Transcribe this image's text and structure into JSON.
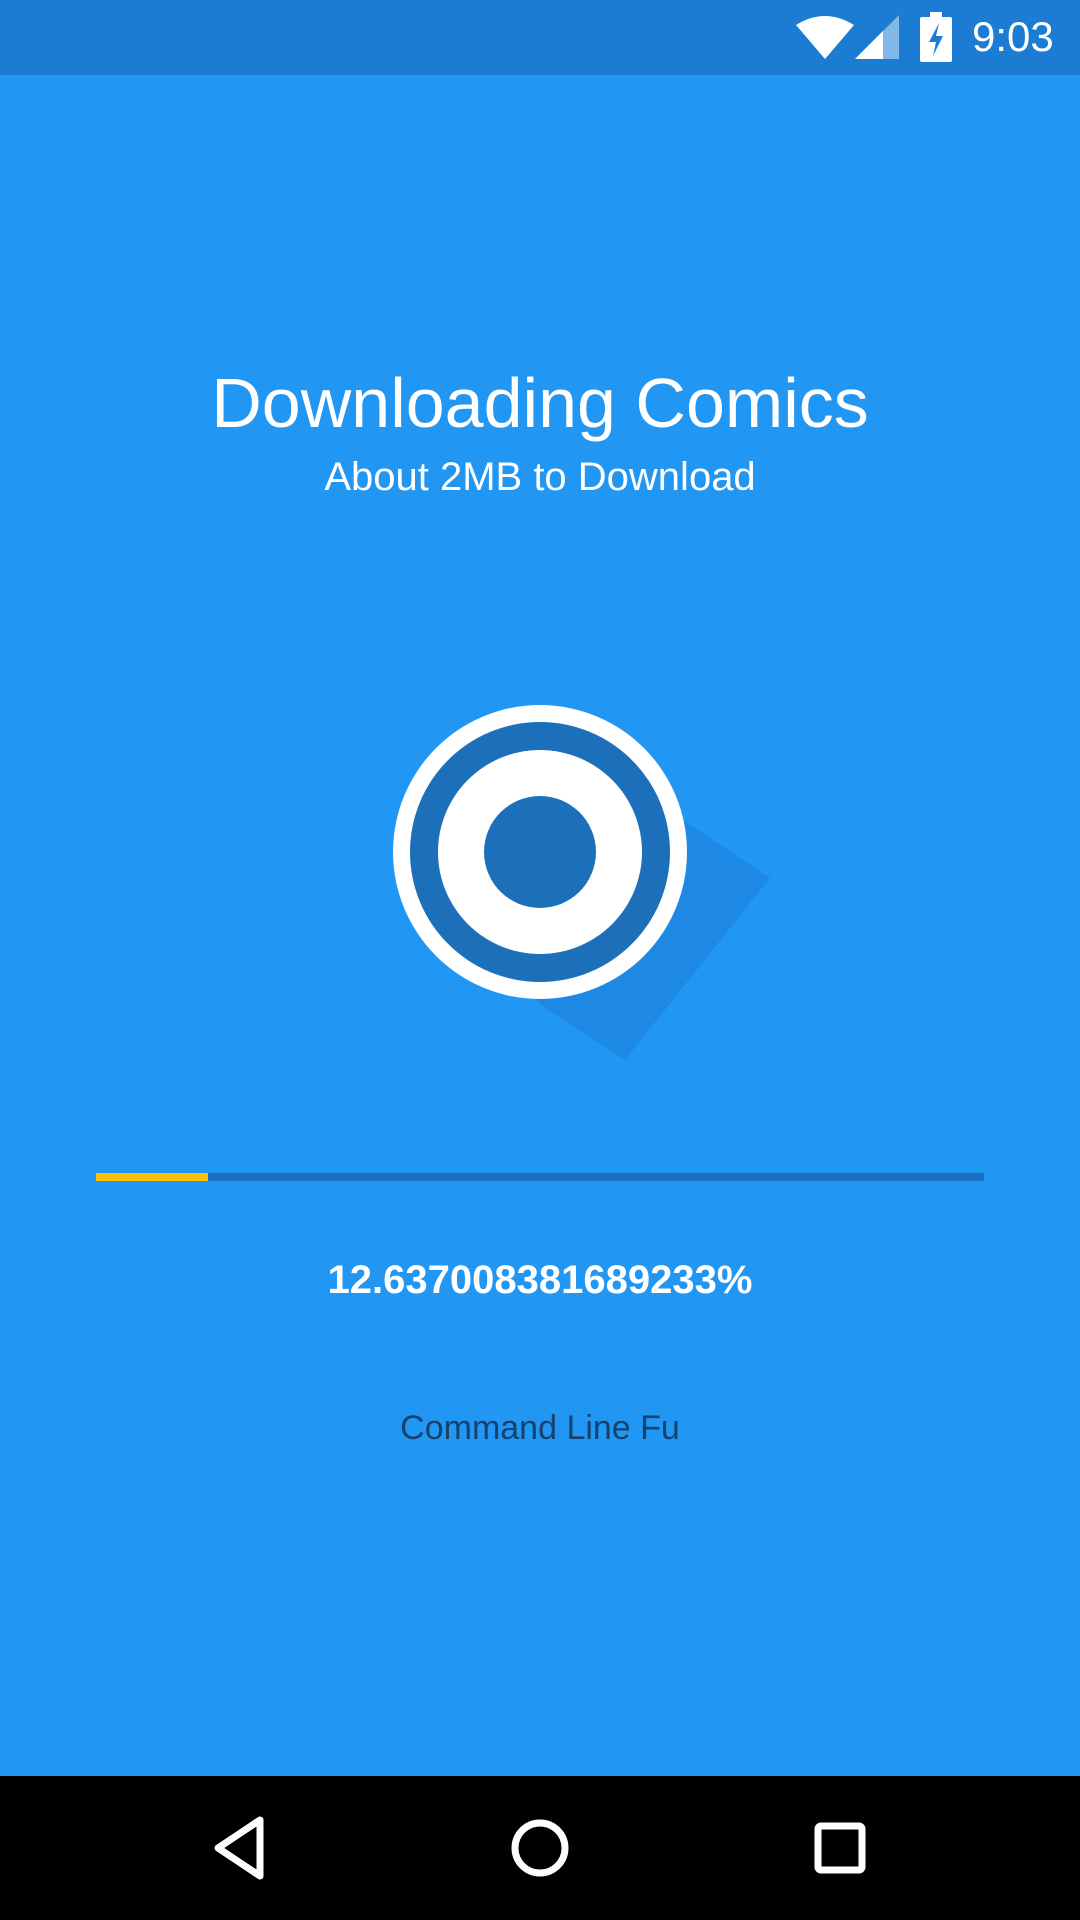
{
  "status_bar": {
    "time": "9:03",
    "icons": [
      "wifi-icon",
      "cell-signal-icon",
      "battery-charging-icon"
    ]
  },
  "download": {
    "title": "Downloading Comics",
    "subtitle": "About 2MB to Download",
    "progress_percent": 12.637008381689233,
    "progress_text": "12.637008381689233%",
    "current_item": "Command Line Fu"
  },
  "logo": {
    "icon": "target-logo-icon"
  },
  "nav_bar": {
    "buttons": [
      "back-icon",
      "home-icon",
      "recents-icon"
    ]
  },
  "colors": {
    "background": "#2196F3",
    "status_bar": "#1C7CD4",
    "progress_track": "#1A6FC0",
    "progress_fill": "#FFC107",
    "comic_name_text": "#16426E"
  }
}
